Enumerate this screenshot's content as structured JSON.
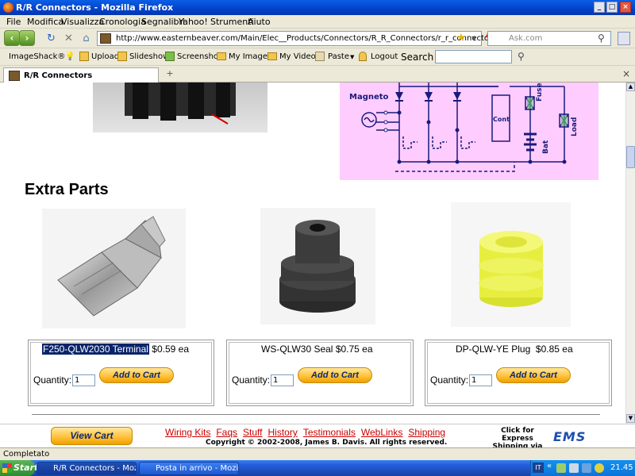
{
  "window": {
    "title": "R/R Connectors - Mozilla Firefox"
  },
  "menu": [
    "File",
    "Modifica",
    "Visualizza",
    "Cronologia",
    "Segnalibri",
    "Yahoo!",
    "Strumenti",
    "Aiuto"
  ],
  "address": {
    "url": "http://www.easternbeaver.com/Main/Elec__Products/Connectors/R_R_Connectors/r_r_connectors.html"
  },
  "search": {
    "placeholder": "Ask.com"
  },
  "toolbar": {
    "imageshack": "ImageShack®",
    "upload": "Upload",
    "slideshow": "Slideshow",
    "screenshot": "Screenshot",
    "my_images": "My Images",
    "my_videos": "My Videos",
    "paste": "Paste",
    "logout": "Logout",
    "search_label": "Search"
  },
  "tab": {
    "label": "R/R Connectors"
  },
  "diagram": {
    "magneto": "Magneto",
    "cont": "Cont",
    "fuse": "Fuse",
    "bat": "Bat",
    "load": "Load"
  },
  "section_title": "Extra Parts",
  "products": [
    {
      "name": "F250-QLW2030 Terminal",
      "price": "$0.59 ea",
      "qty_label": "Quantity:",
      "qty": "1",
      "button": "Add to Cart"
    },
    {
      "name": "WS-QLW30 Seal",
      "price": "$0.75 ea",
      "qty_label": "Quantity:",
      "qty": "1",
      "button": "Add to Cart"
    },
    {
      "name": "DP-QLW-YE Plug",
      "price": "$0.85 ea",
      "qty_label": "Quantity:",
      "qty": "1",
      "button": "Add to Cart"
    }
  ],
  "footer": {
    "view_cart": "View Cart",
    "links": [
      "Wiring Kits",
      "Faqs",
      "Stuff",
      "History",
      "Testimonials",
      "WebLinks",
      "Shipping"
    ],
    "copyright": "Copyright © 2002-2008, James B. Davis. All rights reserved.",
    "express_1": "Click for Express",
    "express_2": "Shipping via",
    "ems": "EMS"
  },
  "status": "Completato",
  "taskbar": {
    "start": "Start",
    "tasks": [
      "R/R Connectors - Moz...",
      "Posta in arrivo - Mozilla T..."
    ],
    "lang": "IT",
    "time": "21.45"
  },
  "colors": {
    "diagram_bg": "#ffccff",
    "link": "#cc0000",
    "cart_button": "#ffc23c",
    "titlebar": "#0342c8"
  }
}
